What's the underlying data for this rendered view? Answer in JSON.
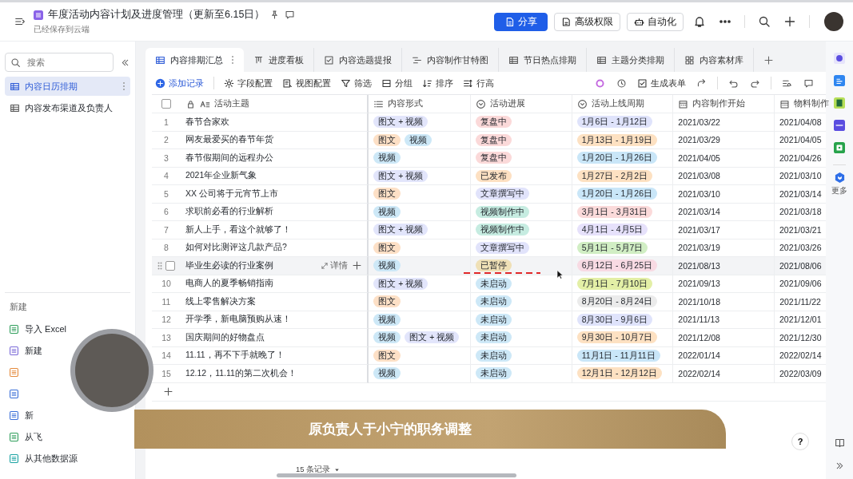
{
  "header": {
    "title": "年度活动内容计划及进度管理（更新至6.15日）",
    "subtitle": "已经保存到云端",
    "buttons": [
      {
        "label": "分享",
        "primary": true
      },
      {
        "label": "高级权限",
        "primary": false
      },
      {
        "label": "自动化",
        "primary": false
      }
    ]
  },
  "sidebar": {
    "search": {
      "placeholder": "搜索"
    },
    "items": [
      {
        "label": "内容日历排期",
        "selected": true
      },
      {
        "label": "内容发布渠道及负责人",
        "selected": false
      }
    ],
    "new_section": {
      "title": "新建",
      "items": [
        {
          "label": "导入 Excel",
          "color": "#2f9e5b"
        },
        {
          "label": "新建",
          "color": "#7b6ad8"
        },
        {
          "color": "#e58a3c"
        },
        {
          "color": "#3a6fd8"
        },
        {
          "label": "新",
          "color": "#3a6fd8"
        },
        {
          "label": "从飞",
          "color": "#2f9e5b"
        },
        {
          "label": "从其他数据源",
          "color": "#1aa3a3"
        }
      ]
    }
  },
  "tabs": [
    {
      "label": "内容排期汇总",
      "kind": "table",
      "selected": true
    },
    {
      "label": "进度看板",
      "kind": "kanban",
      "selected": false
    },
    {
      "label": "内容选题提报",
      "kind": "form",
      "selected": false
    },
    {
      "label": "内容制作甘特图",
      "kind": "gantt",
      "selected": false
    },
    {
      "label": "节日热点排期",
      "kind": "table",
      "selected": false
    },
    {
      "label": "主题分类排期",
      "kind": "table",
      "selected": false
    },
    {
      "label": "内容素材库",
      "kind": "gallery",
      "selected": false
    }
  ],
  "toolbar": {
    "add": "添加记录",
    "items": [
      "字段配置",
      "视图配置",
      "筛选",
      "分组",
      "排序",
      "行高"
    ],
    "form": "生成表单"
  },
  "table": {
    "columns": [
      {
        "label": "活动主题",
        "kind": "title"
      },
      {
        "label": "内容形式",
        "kind": "multi"
      },
      {
        "label": "活动进展",
        "kind": "single"
      },
      {
        "label": "活动上线周期",
        "kind": "single"
      },
      {
        "label": "内容制作开始",
        "kind": "date"
      },
      {
        "label": "物料制作",
        "kind": "date"
      }
    ],
    "detail_label": "详情",
    "select_all_checked": false,
    "rows": [
      {
        "index": "1",
        "highlighted": false,
        "title": "春节合家欢",
        "forms": [
          {
            "label": "图文 + 视频",
            "color": "#e2e5fb"
          }
        ],
        "progress": {
          "label": "复盘中",
          "color": "#fbd9d9"
        },
        "period": {
          "label": "1月6日 - 1月12日",
          "color": "#dfe3fb"
        },
        "start": "2021/03/22",
        "material": "2021/04/08"
      },
      {
        "index": "2",
        "highlighted": false,
        "title": "网友最爱买的春节年货",
        "forms": [
          {
            "label": "图文",
            "color": "#fde0c6"
          },
          {
            "label": "视频",
            "color": "#cde8f7"
          }
        ],
        "progress": {
          "label": "复盘中",
          "color": "#fbd9d9"
        },
        "period": {
          "label": "1月13日 - 1月19日",
          "color": "#fde1c2"
        },
        "start": "2021/03/29",
        "material": "2021/04/05"
      },
      {
        "index": "3",
        "highlighted": false,
        "title": "春节假期间的远程办公",
        "forms": [
          {
            "label": "视频",
            "color": "#cde8f7"
          }
        ],
        "progress": {
          "label": "复盘中",
          "color": "#fbd9d9"
        },
        "period": {
          "label": "1月20日 - 1月26日",
          "color": "#c9e6f8"
        },
        "start": "2021/04/05",
        "material": "2021/04/26"
      },
      {
        "index": "4",
        "highlighted": false,
        "title": "2021年企业新气象",
        "forms": [
          {
            "label": "图文 + 视频",
            "color": "#e2e5fb"
          }
        ],
        "progress": {
          "label": "已发布",
          "color": "#fde0c2"
        },
        "period": {
          "label": "1月27日 - 2月2日",
          "color": "#fde1c2"
        },
        "start": "2021/03/08",
        "material": "2021/03/10"
      },
      {
        "index": "5",
        "highlighted": false,
        "title": "XX 公司将于元宵节上市",
        "forms": [
          {
            "label": "图文",
            "color": "#fde0c6"
          }
        ],
        "progress": {
          "label": "文章撰写中",
          "color": "#e1e3fb"
        },
        "period": {
          "label": "1月20日 - 1月26日",
          "color": "#c9e6f8"
        },
        "start": "2021/03/10",
        "material": "2021/03/14"
      },
      {
        "index": "6",
        "highlighted": false,
        "title": "求职前必看的行业解析",
        "forms": [
          {
            "label": "视频",
            "color": "#cde8f7"
          }
        ],
        "progress": {
          "label": "视频制作中",
          "color": "#c6ece1"
        },
        "period": {
          "label": "3月1日 - 3月31日",
          "color": "#fbdada"
        },
        "start": "2021/03/14",
        "material": "2021/03/18"
      },
      {
        "index": "7",
        "highlighted": false,
        "title": "新人上手，看这个就够了！",
        "forms": [
          {
            "label": "图文 + 视频",
            "color": "#e2e5fb"
          }
        ],
        "progress": {
          "label": "视频制作中",
          "color": "#c6ece1"
        },
        "period": {
          "label": "4月1日 - 4月5日",
          "color": "#e6e1fb"
        },
        "start": "2021/03/17",
        "material": "2021/03/21"
      },
      {
        "index": "8",
        "highlighted": false,
        "title": "如何对比测评这几款产品?",
        "forms": [
          {
            "label": "图文",
            "color": "#fde0c6"
          }
        ],
        "progress": {
          "label": "文章撰写中",
          "color": "#e1e3fb"
        },
        "period": {
          "label": "5月1日 - 5月7日",
          "color": "#d1eec4"
        },
        "start": "2021/03/19",
        "material": "2021/03/26"
      },
      {
        "highlighted": true,
        "checked": false,
        "title": "毕业生必读的行业案例",
        "forms": [
          {
            "label": "视频",
            "color": "#cde8f7"
          }
        ],
        "progress": {
          "label": "已暂停",
          "color": "#efe0b6"
        },
        "period": {
          "label": "6月12日 - 6月25日",
          "color": "#f8dae3"
        },
        "start": "2021/08/13",
        "material": "2021/08/06"
      },
      {
        "index": "10",
        "highlighted": false,
        "title": "电商人的夏季畅销指南",
        "forms": [
          {
            "label": "图文 + 视频",
            "color": "#e2e5fb"
          }
        ],
        "progress": {
          "label": "未启动",
          "color": "#cde8f7"
        },
        "period": {
          "label": "7月1日 - 7月10日",
          "color": "#e3efa6"
        },
        "start": "2021/09/13",
        "material": "2021/09/06"
      },
      {
        "index": "11",
        "highlighted": false,
        "title": "线上零售解决方案",
        "forms": [
          {
            "label": "图文",
            "color": "#fde0c6"
          }
        ],
        "progress": {
          "label": "未启动",
          "color": "#cde8f7"
        },
        "period": {
          "label": "8月20日 - 8月24日",
          "color": "#ebebeb"
        },
        "start": "2021/10/18",
        "material": "2021/11/22"
      },
      {
        "index": "12",
        "highlighted": false,
        "title": "开学季，新电脑预购从速！",
        "forms": [
          {
            "label": "视频",
            "color": "#cde8f7"
          }
        ],
        "progress": {
          "label": "未启动",
          "color": "#cde8f7"
        },
        "period": {
          "label": "8月30日 - 9月6日",
          "color": "#dfe3fb"
        },
        "start": "2021/11/13",
        "material": "2021/12/01"
      },
      {
        "index": "13",
        "highlighted": false,
        "title": "国庆期间的好物盘点",
        "forms": [
          {
            "label": "视频",
            "color": "#cde8f7"
          },
          {
            "label": "图文 + 视频",
            "color": "#e2e5fb"
          }
        ],
        "progress": {
          "label": "未启动",
          "color": "#cde8f7"
        },
        "period": {
          "label": "9月30日 - 10月7日",
          "color": "#fde1c2"
        },
        "start": "2021/12/08",
        "material": "2021/12/30"
      },
      {
        "index": "14",
        "highlighted": false,
        "title": "11.11，再不下手就晚了！",
        "forms": [
          {
            "label": "图文",
            "color": "#fde0c6"
          }
        ],
        "progress": {
          "label": "未启动",
          "color": "#cde8f7"
        },
        "period": {
          "label": "11月1日 - 11月11日",
          "color": "#c9e6f8"
        },
        "start": "2022/01/14",
        "material": "2022/02/14"
      },
      {
        "index": "15",
        "highlighted": false,
        "title": "12.12，11.11的第二次机会！",
        "forms": [
          {
            "label": "视频",
            "color": "#cde8f7"
          }
        ],
        "progress": {
          "label": "未启动",
          "color": "#cde8f7"
        },
        "period": {
          "label": "12月1日 - 12月12日",
          "color": "#fde1c2"
        },
        "start": "2022/02/14",
        "material": "2022/03/09"
      }
    ]
  },
  "footer": {
    "record_count": "15 条记录"
  },
  "caption": "原负责人于小宁的职务调整",
  "help_button": "?",
  "right_rail": {
    "more_label": "更多"
  }
}
